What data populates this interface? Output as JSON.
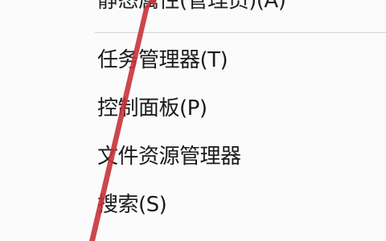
{
  "context_menu": {
    "items": [
      {
        "label": "静态属性(管理员)(A)"
      },
      {
        "label": "任务管理器(T)"
      },
      {
        "label": "控制面板(P)"
      },
      {
        "label": "文件资源管理器"
      },
      {
        "label": "搜索(S)"
      }
    ]
  },
  "colors": {
    "menu_background": "#fbfbfb",
    "text": "#1a1a1a",
    "separator": "#d6d6d6",
    "annotation_arrow": "#c8323a"
  },
  "icons": {
    "annotation": "red-arrow-annotation"
  }
}
